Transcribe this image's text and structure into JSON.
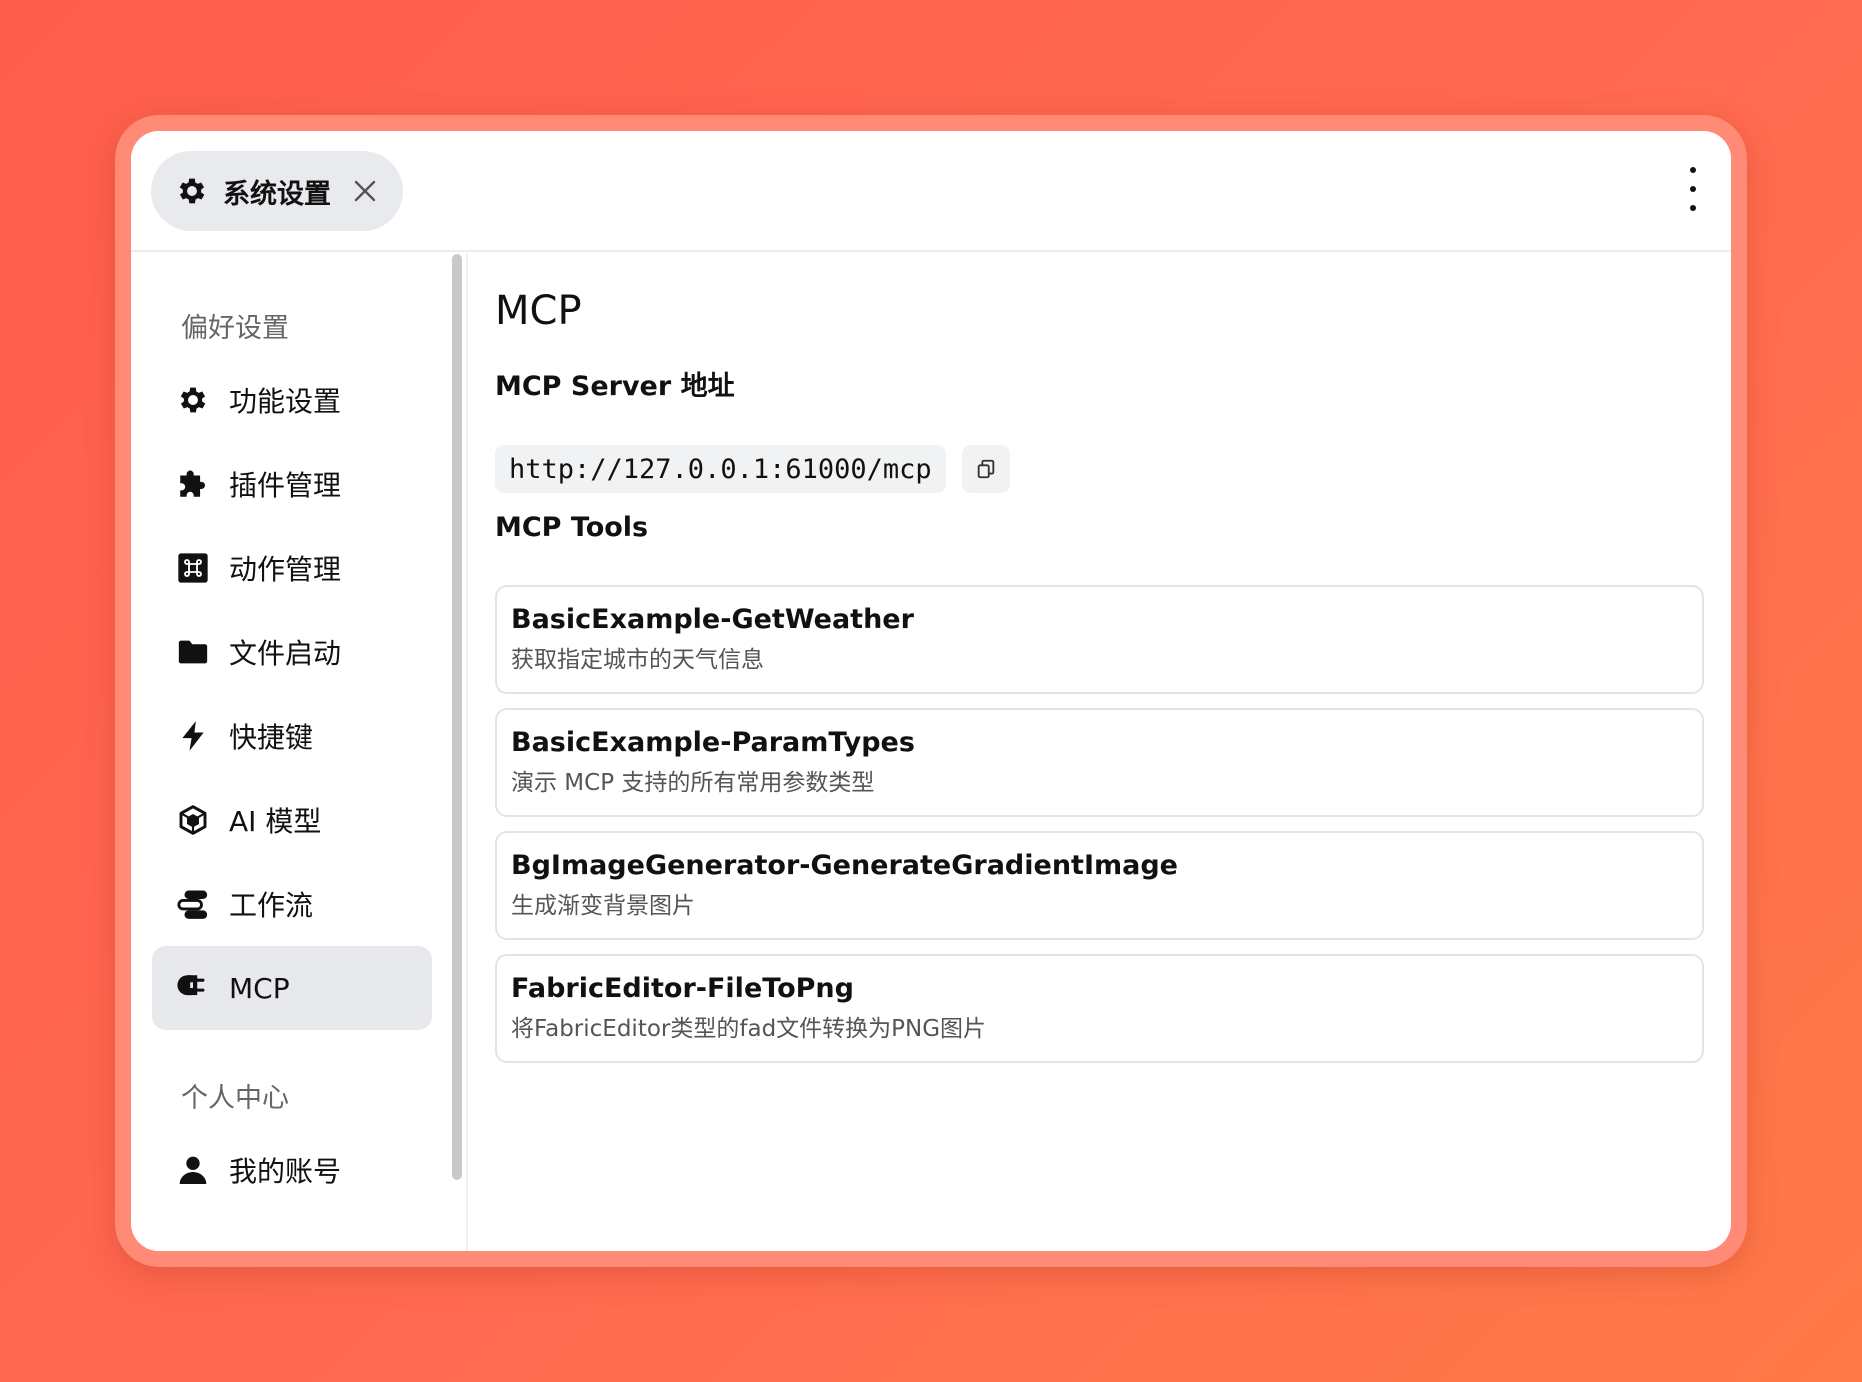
{
  "header": {
    "tab_label": "系统设置",
    "tab_icon": "gear-icon",
    "close_icon": "close-icon",
    "more_icon": "more-vertical-icon"
  },
  "sidebar": {
    "sections": [
      {
        "title": "偏好设置",
        "items": [
          {
            "label": "功能设置",
            "icon": "gear-icon"
          },
          {
            "label": "插件管理",
            "icon": "puzzle-icon"
          },
          {
            "label": "动作管理",
            "icon": "command-icon"
          },
          {
            "label": "文件启动",
            "icon": "folder-icon"
          },
          {
            "label": "快捷键",
            "icon": "bolt-icon"
          },
          {
            "label": "AI 模型",
            "icon": "cube-icon"
          },
          {
            "label": "工作流",
            "icon": "workflow-icon"
          },
          {
            "label": "MCP",
            "icon": "plug-icon",
            "active": true
          }
        ]
      },
      {
        "title": "个人中心",
        "items": [
          {
            "label": "我的账号",
            "icon": "user-icon"
          }
        ]
      }
    ]
  },
  "main": {
    "title": "MCP",
    "server_heading": "MCP Server 地址",
    "server_url": "http://127.0.0.1:61000/mcp",
    "tools_heading": "MCP Tools",
    "tools": [
      {
        "name": "BasicExample-GetWeather",
        "description": "获取指定城市的天气信息"
      },
      {
        "name": "BasicExample-ParamTypes",
        "description": "演示 MCP 支持的所有常用参数类型"
      },
      {
        "name": "BgImageGenerator-GenerateGradientImage",
        "description": "生成渐变背景图片"
      },
      {
        "name": "FabricEditor-FileToPng",
        "description": "将FabricEditor类型的fad文件转换为PNG图片"
      }
    ]
  }
}
